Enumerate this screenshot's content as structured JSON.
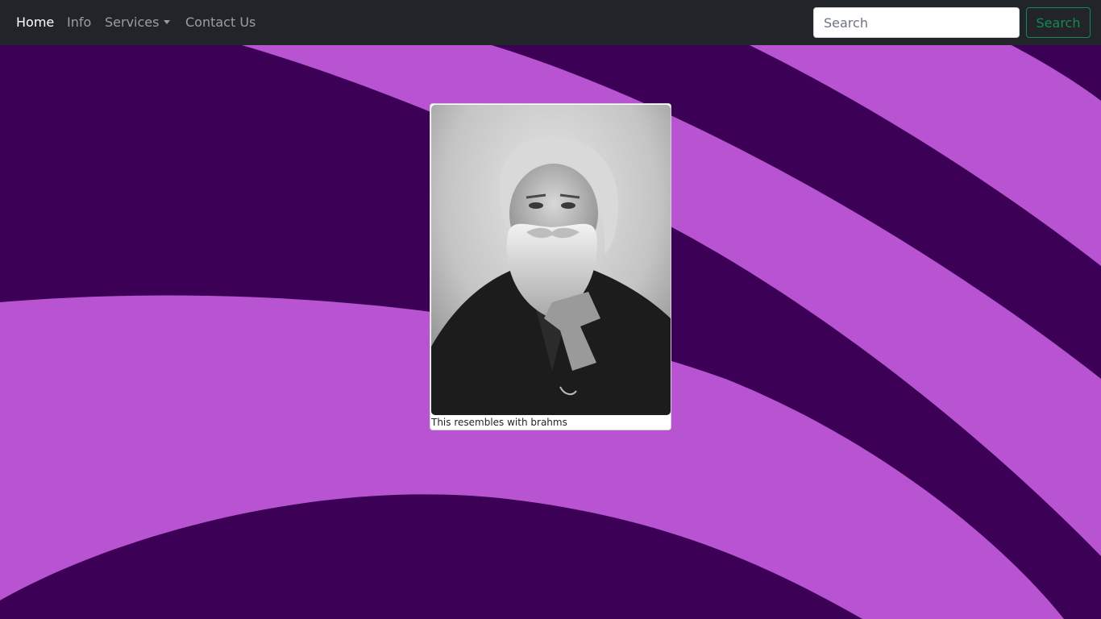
{
  "navbar": {
    "links": [
      {
        "label": "Home",
        "active": true
      },
      {
        "label": "Info",
        "active": false
      },
      {
        "label": "Services",
        "active": false,
        "dropdown": true
      },
      {
        "label": "Contact Us",
        "active": false
      }
    ],
    "search": {
      "placeholder": "Search",
      "value": ""
    },
    "search_button_label": "Search"
  },
  "card": {
    "caption": "This resembles with brahms",
    "image_subject": "portrait-photo"
  },
  "colors": {
    "navbar_bg": "#212529",
    "bg_dark": "#3d0057",
    "bg_light": "#b853d1",
    "search_button": "#198754"
  }
}
